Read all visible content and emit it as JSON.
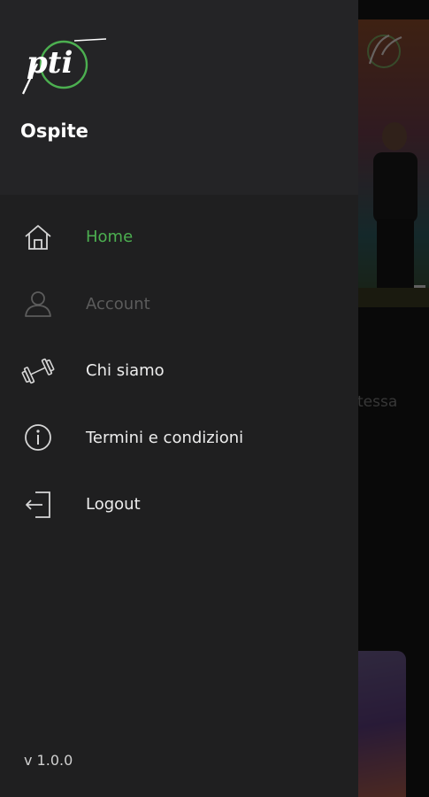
{
  "drawer": {
    "user_name": "Ospite",
    "logo_text": "pti",
    "menu": [
      {
        "label": "Home",
        "state": "active",
        "icon": "home-icon"
      },
      {
        "label": "Account",
        "state": "disabled",
        "icon": "user-icon"
      },
      {
        "label": "Chi siamo",
        "state": "normal",
        "icon": "dumbbell-icon"
      },
      {
        "label": "Termini e condizioni",
        "state": "normal",
        "icon": "info-icon"
      },
      {
        "label": "Logout",
        "state": "normal",
        "icon": "logout-icon"
      }
    ],
    "version": "v 1.0.0"
  },
  "background": {
    "partial_text": "tessa"
  },
  "colors": {
    "accent": "#4caf50",
    "drawer_bg": "#1f1f20",
    "header_bg": "#242426"
  }
}
